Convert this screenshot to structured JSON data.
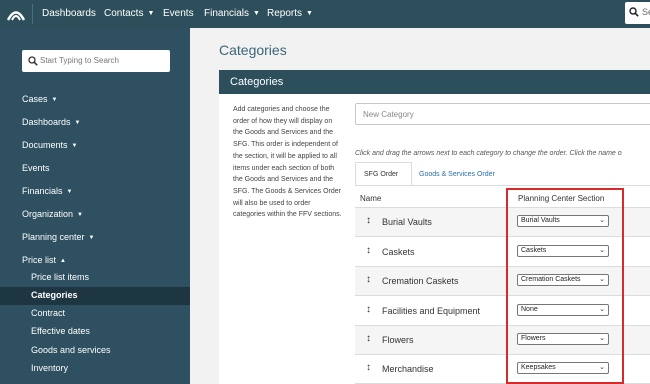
{
  "topnav": {
    "items": [
      {
        "label": "Dashboards",
        "caret": false
      },
      {
        "label": "Contacts",
        "caret": true
      },
      {
        "label": "Events",
        "caret": false
      },
      {
        "label": "Financials",
        "caret": true
      },
      {
        "label": "Reports",
        "caret": true
      }
    ],
    "search_placeholder": "Se"
  },
  "sidebar": {
    "search_placeholder": "Start Typing to Search",
    "items": [
      {
        "label": "Cases",
        "caret": "down"
      },
      {
        "label": "Dashboards",
        "caret": "down"
      },
      {
        "label": "Documents",
        "caret": "down"
      },
      {
        "label": "Events",
        "caret": ""
      },
      {
        "label": "Financials",
        "caret": "down"
      },
      {
        "label": "Organization",
        "caret": "down"
      },
      {
        "label": "Planning center",
        "caret": "down"
      },
      {
        "label": "Price list",
        "caret": "up"
      }
    ],
    "subitems": [
      {
        "label": "Price list items"
      },
      {
        "label": "Categories",
        "active": true
      },
      {
        "label": "Contract"
      },
      {
        "label": "Effective dates"
      },
      {
        "label": "Goods and services"
      },
      {
        "label": "Inventory"
      }
    ]
  },
  "page": {
    "title": "Categories",
    "panel_title": "Categories",
    "description": "Add categories and choose the order of how they will display on the Goods and Services and the SFG. This order is independent of the section, it will be applied to all items under each section of both the Goods and Services and the SFG. The Goods & Services Order will also be used to order categories within the FFV sections.",
    "new_category_placeholder": "New Category",
    "hint": "Click and drag the arrows next to each category to change the order. Click the name o",
    "tabs": [
      {
        "label": "SFG Order",
        "active": true
      },
      {
        "label": "Goods & Services Order",
        "active": false
      }
    ],
    "columns": {
      "name": "Name",
      "planning": "Planning Center Section"
    },
    "rows": [
      {
        "name": "Burial Vaults",
        "section": "Burial Vaults"
      },
      {
        "name": "Caskets",
        "section": "Caskets"
      },
      {
        "name": "Cremation Caskets",
        "section": "Cremation Caskets"
      },
      {
        "name": "Facilities and Equipment",
        "section": "None"
      },
      {
        "name": "Flowers",
        "section": "Flowers"
      },
      {
        "name": "Merchandise",
        "section": "Keepsakes"
      }
    ]
  },
  "colors": {
    "topbar": "#2d4f5c",
    "sidebar": "#2e5060",
    "sidebar_active": "#1d3642",
    "title": "#3a6677",
    "link": "#2a6fa8",
    "highlight": "#d82a2a"
  },
  "icons": [
    "logo-icon",
    "search-icon",
    "chevron-down-icon",
    "chevron-up-icon",
    "drag-handle-icon"
  ]
}
